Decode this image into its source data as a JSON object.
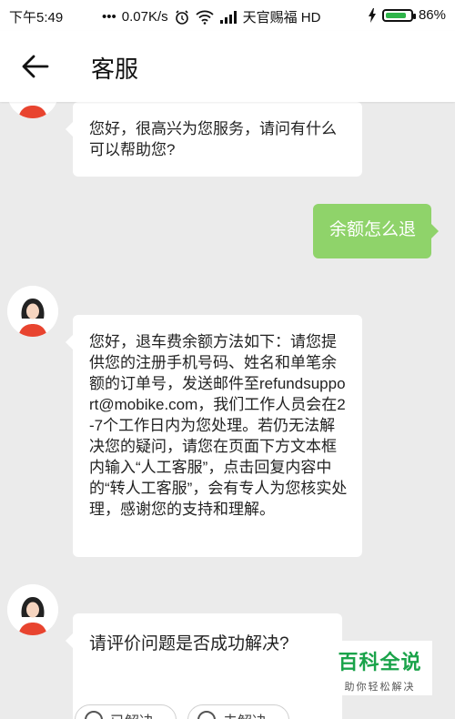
{
  "status_bar": {
    "time": "下午5:49",
    "network_speed": "0.07K/s",
    "carrier": "天官赐福 HD",
    "battery_percent": "86%",
    "battery_level": 0.86
  },
  "header": {
    "title": "客服",
    "back_icon": "arrow-left-icon"
  },
  "messages": [
    {
      "from": "agent",
      "text": "您好，很高兴为您服务，请问有什么可以帮助您?"
    },
    {
      "from": "user",
      "text": "余额怎么退"
    },
    {
      "from": "agent",
      "text": "您好，退车费余额方法如下：请您提供您的注册手机号码、姓名和单笔余额的订单号，发送邮件至refundsupport@mobike.com，我们工作人员会在2-7个工作日内为您处理。若仍无法解决您的疑问，请您在页面下方文本框内输入“人工客服”，点击回复内容中的“转人工客服”，会有专人为您核实处理，感谢您的支持和理解。"
    },
    {
      "from": "agent",
      "text": "请评价问题是否成功解决?"
    }
  ],
  "feedback_buttons": {
    "resolved": "已解决",
    "unresolved": "未解决"
  },
  "watermark": {
    "title": "百科全说",
    "subtitle": "助你轻松解决"
  },
  "colors": {
    "user_bubble": "#8fd36a",
    "battery_fill": "#2fb44a",
    "watermark_green": "#1aa34a"
  }
}
